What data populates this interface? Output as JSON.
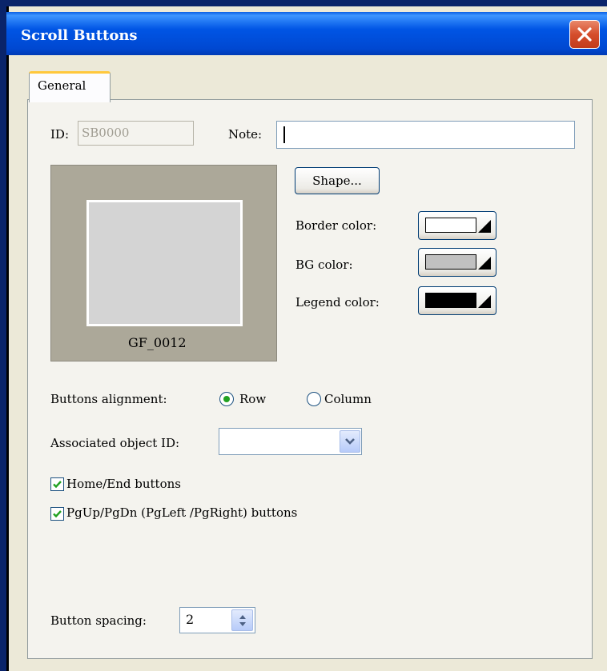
{
  "window": {
    "title": "Scroll Buttons"
  },
  "tabs": [
    {
      "label": "General",
      "selected": true
    }
  ],
  "general": {
    "id_label": "ID:",
    "id_value": "SB0000",
    "note_label": "Note:",
    "note_value": "",
    "preview_caption": "GF_0012",
    "shape_button": "Shape...",
    "border_color_label": "Border color:",
    "border_color": "#ffffff",
    "bg_color_label": "BG color:",
    "bg_color": "#c0c0c0",
    "legend_color_label": "Legend color:",
    "legend_color": "#000000",
    "alignment_label": "Buttons alignment:",
    "alignment_options": [
      "Row",
      "Column"
    ],
    "alignment_selected": "Row",
    "assoc_label": "Associated object ID:",
    "assoc_value": "",
    "home_end_label": "Home/End buttons",
    "home_end_checked": true,
    "pgup_label": "PgUp/PgDn (PgLeft /PgRight) buttons",
    "pgup_checked": true,
    "spacing_label": "Button spacing:",
    "spacing_value": "2"
  },
  "icons": {
    "close": "close-icon",
    "dropdown": "chevron-down-icon",
    "check": "checkmark-icon",
    "spin": "spin-up-down-icon"
  }
}
